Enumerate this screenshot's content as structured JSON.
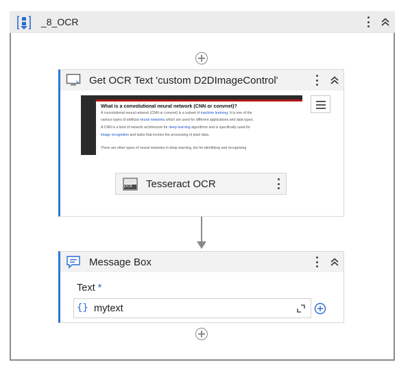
{
  "sequence": {
    "title": "_8_OCR",
    "icon": "sequence-icon"
  },
  "ocr_activity": {
    "title": "Get OCR Text 'custom  D2DImageControl'",
    "icon": "screen-icon",
    "preview": {
      "heading": "What is a convolutional neural network (CNN or convnet)?",
      "lines": [
        [
          "A convolutional neural network (CNN or convnet) is a subset of ",
          "machine learning",
          ". It is one of the"
        ],
        [
          "various types of artificial ",
          "neural networks",
          " which are used for different applications and data types."
        ],
        [
          "A CNN is a kind of network architecture for ",
          "deep learning",
          " algorithms and is specifically used for"
        ],
        [
          "",
          "image recognition",
          " and tasks that involve the processing of pixel data."
        ],
        [
          "There are other types of neural networks in deep learning, but for identifying and recognizing",
          "",
          ""
        ]
      ]
    },
    "engine": {
      "label": "Tesseract OCR",
      "icon": "ocr-engine-icon",
      "icon_text": "OCR"
    }
  },
  "message_box": {
    "title": "Message Box",
    "icon": "message-icon",
    "field_label": "Text",
    "required_mark": "*",
    "field_prefix": "{}",
    "field_value": "mytext"
  }
}
